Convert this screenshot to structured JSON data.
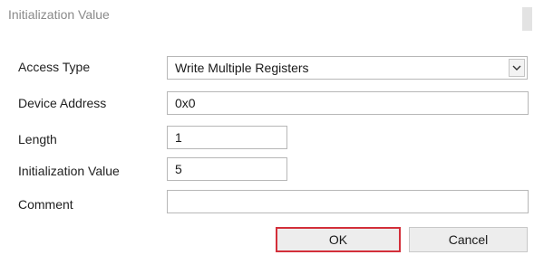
{
  "dialog": {
    "title": "Initialization Value"
  },
  "fields": {
    "access_type": {
      "label": "Access Type",
      "value": "Write Multiple Registers"
    },
    "device_address": {
      "label": "Device Address",
      "value": "0x0"
    },
    "length": {
      "label": "Length",
      "value": "1"
    },
    "initialization_value": {
      "label": "Initialization Value",
      "value": "5"
    },
    "comment": {
      "label": "Comment",
      "value": ""
    }
  },
  "buttons": {
    "ok_label": "OK",
    "cancel_label": "Cancel"
  },
  "icons": {
    "dropdown": "chevron-down-icon"
  },
  "colors": {
    "focus_border": "#d32f3a",
    "title_text": "#8a8a8a"
  }
}
